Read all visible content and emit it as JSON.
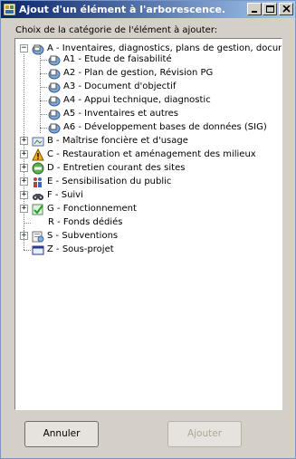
{
  "window": {
    "title": "Ajout d'un élément à l'arborescence.",
    "controls": {
      "minimize": "_",
      "maximize": "□",
      "close": "X"
    }
  },
  "prompt": "Choix de la catégorie de l'élément à ajouter:",
  "tree": {
    "root": {
      "label": "A - Inventaires, diagnostics, plans de gestion, documents d'o",
      "expanded": true,
      "icon": "study-icon",
      "children": [
        {
          "label": "A1 - Etude de faisabilité",
          "icon": "study-icon"
        },
        {
          "label": "A2 - Plan de gestion, Révision PG",
          "icon": "study-icon"
        },
        {
          "label": "A3 - Document d'objectif",
          "icon": "study-icon"
        },
        {
          "label": "A4 - Appui technique, diagnostic",
          "icon": "study-icon"
        },
        {
          "label": "A5 - Inventaires et autres",
          "icon": "study-icon"
        },
        {
          "label": "A6 - Développement bases de données (SIG)",
          "icon": "study-icon"
        }
      ]
    },
    "categories": [
      {
        "label": "B - Maîtrise foncière et d'usage",
        "icon": "land-icon",
        "expander": "+"
      },
      {
        "label": "C - Restauration et aménagement des milieux",
        "icon": "warning-icon",
        "expander": "+"
      },
      {
        "label": "D - Entretien courant des sites",
        "icon": "maintenance-icon",
        "expander": "+"
      },
      {
        "label": "E - Sensibilisation du public",
        "icon": "public-icon",
        "expander": "+"
      },
      {
        "label": "F - Suivi",
        "icon": "monitoring-icon",
        "expander": "+"
      },
      {
        "label": "G - Fonctionnement",
        "icon": "check-icon",
        "expander": "+"
      },
      {
        "label": "R - Fonds dédiés",
        "icon": "",
        "expander": ""
      },
      {
        "label": "S - Subventions",
        "icon": "grant-icon",
        "expander": "+"
      },
      {
        "label": "Z - Sous-projet",
        "icon": "subproject-icon",
        "expander": ""
      }
    ]
  },
  "buttons": {
    "cancel": "Annuler",
    "add": "Ajouter",
    "add_enabled": false
  }
}
